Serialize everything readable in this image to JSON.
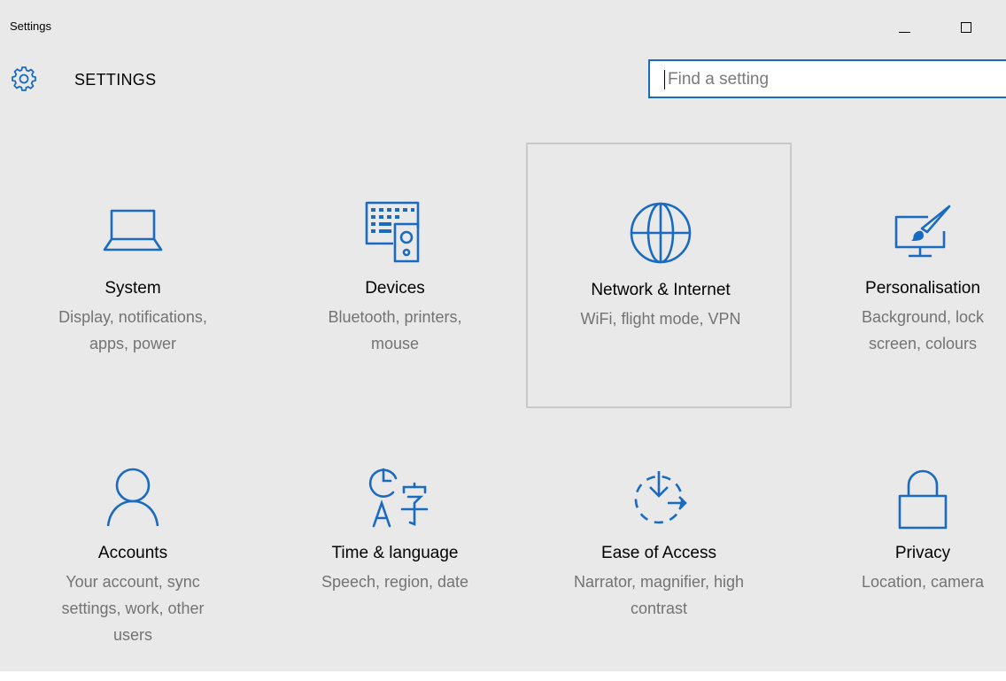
{
  "window": {
    "title": "Settings",
    "controls": {
      "minimize_icon": "minimize-icon",
      "maximize_icon": "maximize-icon"
    }
  },
  "header": {
    "title": "SETTINGS",
    "icon": "gear-icon",
    "search_placeholder": "Find a setting",
    "search_value": ""
  },
  "colors": {
    "accent": "#1a6bc0",
    "background": "#e9e9e9",
    "description_text": "#737373",
    "selection_border": "#c9c9c9"
  },
  "categories": [
    {
      "title": "System",
      "description": "Display, notifications, apps, power",
      "icon": "laptop-icon",
      "selected": false
    },
    {
      "title": "Devices",
      "description": "Bluetooth, printers, mouse",
      "icon": "devices-icon",
      "selected": false
    },
    {
      "title": "Network & Internet",
      "description": "WiFi, flight mode, VPN",
      "icon": "globe-icon",
      "selected": true
    },
    {
      "title": "Personalisation",
      "description": "Background, lock screen, colours",
      "icon": "paintbrush-monitor-icon",
      "selected": false
    },
    {
      "title": "Accounts",
      "description": "Your account, sync settings, work, other users",
      "icon": "person-icon",
      "selected": false
    },
    {
      "title": "Time & language",
      "description": "Speech, region, date",
      "icon": "clock-language-icon",
      "selected": false
    },
    {
      "title": "Ease of Access",
      "description": "Narrator, magnifier, high contrast",
      "icon": "ease-of-access-icon",
      "selected": false
    },
    {
      "title": "Privacy",
      "description": "Location, camera",
      "icon": "lock-icon",
      "selected": false
    }
  ]
}
